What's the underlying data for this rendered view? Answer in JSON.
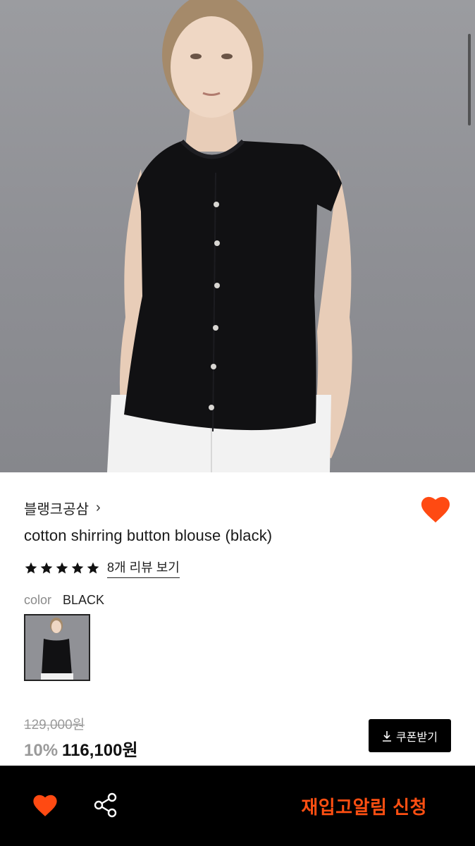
{
  "colors": {
    "accent": "#ff4f12",
    "heart": "#ff4a12",
    "star": "#111111"
  },
  "product": {
    "brand": "블랭크공삼",
    "name": "cotton shirring button blouse (black)",
    "rating": 5,
    "review_link": "8개 리뷰 보기",
    "color_label": "color",
    "color_value": "BLACK",
    "original_price": "129,000원",
    "discount": "10%",
    "price": "116,100원",
    "coupon_label": "쿠폰받기"
  },
  "bottom_bar": {
    "restock_label": "재입고알림 신청"
  },
  "icons": {
    "wishlist": "heart-icon",
    "share": "share-icon",
    "download": "download-icon",
    "chevron": "chevron-right-icon"
  }
}
